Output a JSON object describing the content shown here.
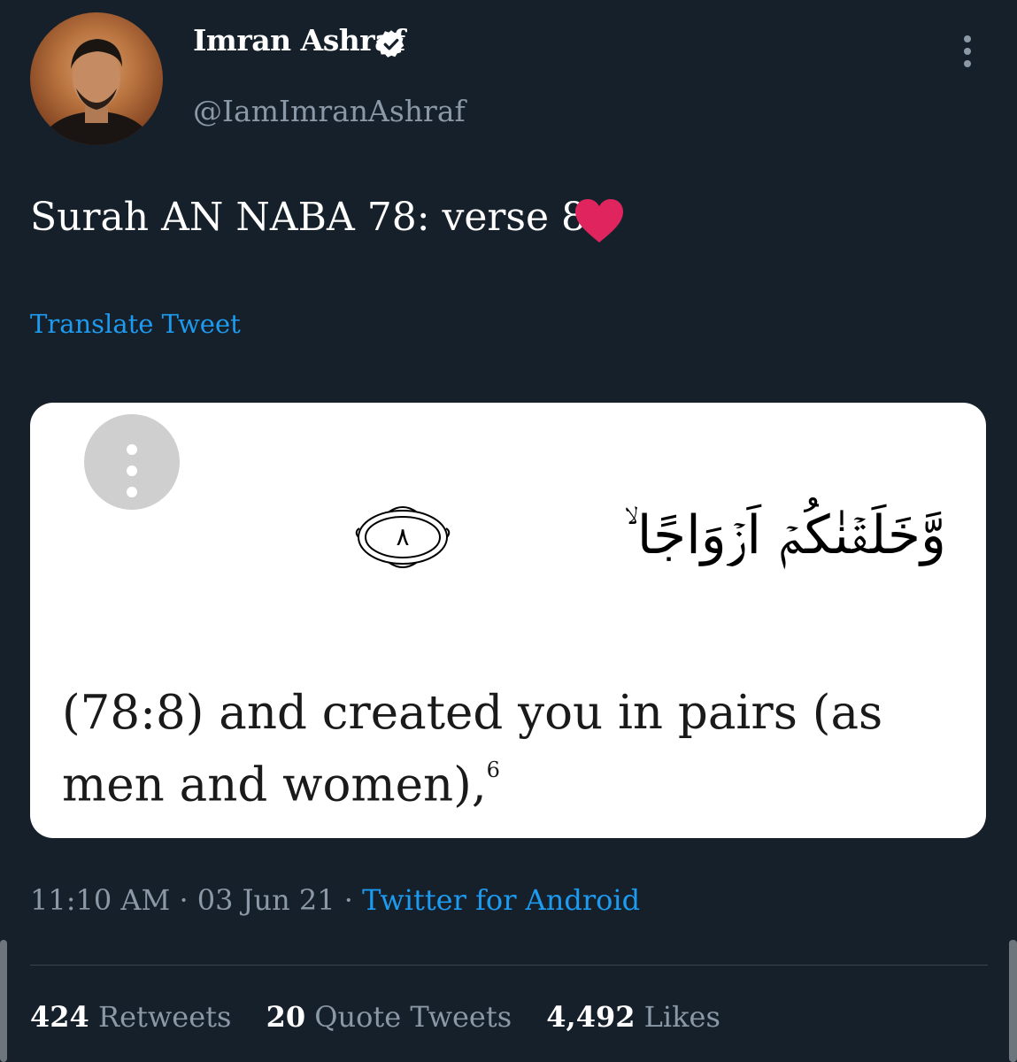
{
  "tweet": {
    "author": {
      "name": "Imran Ashraf",
      "handle": "@IamImranAshraf",
      "verified": true
    },
    "text": "Surah AN NABA 78: verse 8",
    "emoji": "heart",
    "translate_label": "Translate Tweet",
    "media": {
      "arabic": "وَّخَلَقۡنٰكُمۡ اَزۡوَاجًا ۙ",
      "verse_number": "٨",
      "translation_line1": "(78:8) and created you in pairs (as",
      "translation_line2": "men and women),",
      "footnote": "6"
    },
    "time": "11:10 AM",
    "separator": "·",
    "date": "03 Jun 21",
    "source": "Twitter for Android",
    "stats": {
      "retweets_count": "424",
      "retweets_label": "Retweets",
      "quotes_count": "20",
      "quotes_label": "Quote Tweets",
      "likes_count": "4,492",
      "likes_label": "Likes"
    }
  },
  "colors": {
    "background": "#16202b",
    "accent": "#1d9bf0",
    "secondary_text": "#8b98a5",
    "heart": "#e0245e"
  },
  "icons": [
    "verified-badge-icon",
    "more-vertical-icon",
    "heart-emoji-icon",
    "menu-dots-icon"
  ]
}
